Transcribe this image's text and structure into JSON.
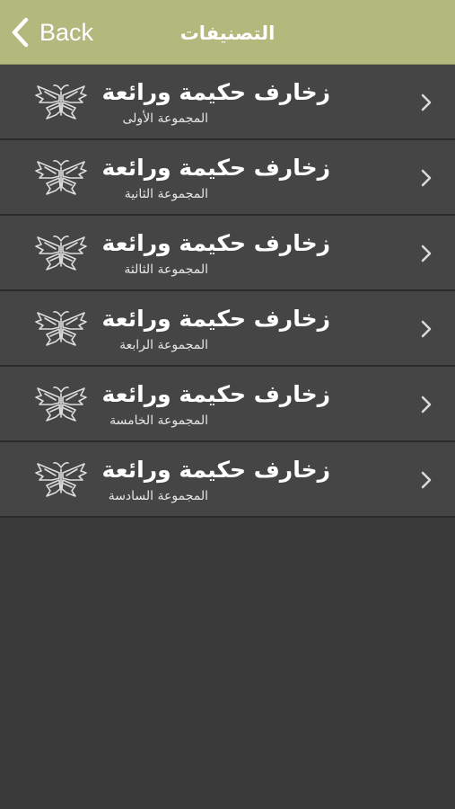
{
  "navbar": {
    "back_label": "Back",
    "title": "التصنيفات",
    "background_color": "#b3b87c"
  },
  "list": {
    "items": [
      {
        "title": "زخارف حكيمة ورائعة",
        "subtitle": "المجموعة الأولى",
        "icon": "butterfly-icon"
      },
      {
        "title": "زخارف حكيمة ورائعة",
        "subtitle": "المجموعة الثانية",
        "icon": "butterfly-icon"
      },
      {
        "title": "زخارف حكيمة ورائعة",
        "subtitle": "المجموعة الثالثة",
        "icon": "butterfly-icon"
      },
      {
        "title": "زخارف حكيمة ورائعة",
        "subtitle": "المجموعة الرابعة",
        "icon": "butterfly-icon"
      },
      {
        "title": "زخارف حكيمة ورائعة",
        "subtitle": "المجموعة الخامسة",
        "icon": "butterfly-icon"
      },
      {
        "title": "زخارف حكيمة ورائعة",
        "subtitle": "المجموعة السادسة",
        "icon": "butterfly-icon"
      }
    ],
    "row_color": "#454545",
    "background_color": "#3a3a3a"
  }
}
